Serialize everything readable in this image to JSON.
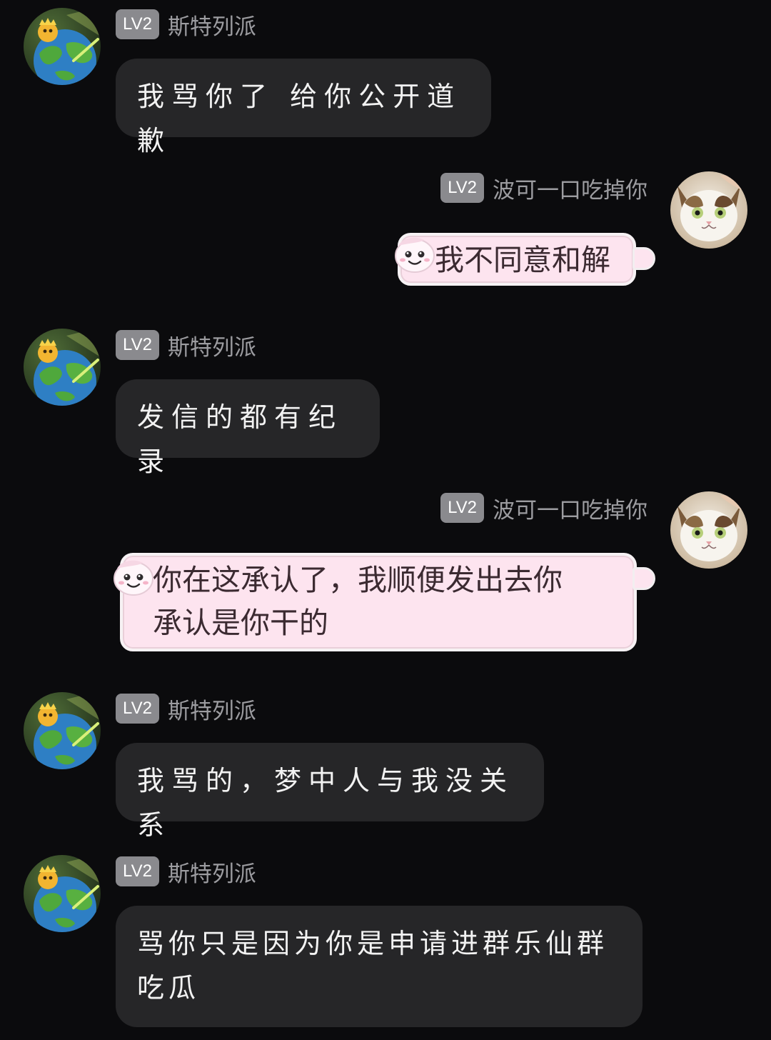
{
  "messages": [
    {
      "side": "left",
      "level": "LV2",
      "user": "斯特列派",
      "text": "我骂你了 给你公开道歉"
    },
    {
      "side": "right",
      "level": "LV2",
      "user": "波可一口吃掉你",
      "text": "我不同意和解"
    },
    {
      "side": "left",
      "level": "LV2",
      "user": "斯特列派",
      "text": "发信的都有纪录"
    },
    {
      "side": "right",
      "level": "LV2",
      "user": "波可一口吃掉你",
      "text_line1": "你在这承认了，我顺便发出去你",
      "text_line2": "承认是你干的"
    },
    {
      "side": "left",
      "level": "LV2",
      "user": "斯特列派",
      "text": "我骂的，梦中人与我没关系"
    },
    {
      "side": "left",
      "level": "LV2",
      "user": "斯特列派",
      "text_line1": "骂你只是因为你是申请进群乐仙群",
      "text_line2": "吃瓜"
    }
  ],
  "icons": {
    "left_avatar": "earth-planet-avatar",
    "right_avatar": "cat-avatar",
    "bubble_sticker": "pink-character-sticker-icon"
  },
  "colors": {
    "background": "#0b0b0d",
    "dark_bubble": "#262628",
    "pink_bubble": "#fde4ef",
    "level_badge": "#8a8a8e",
    "username": "#9c9ca0"
  }
}
